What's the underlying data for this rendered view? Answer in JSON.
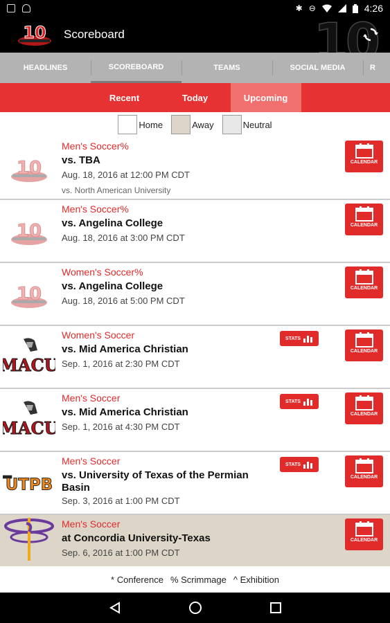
{
  "status_bar": {
    "time": "4:26",
    "left_icons": [
      "download-icon",
      "android-icon"
    ],
    "right_icons": [
      "bluetooth-icon",
      "minus-circle-icon",
      "wifi-icon",
      "signal-icon",
      "battery-icon"
    ]
  },
  "app_bar": {
    "title": "Scoreboard",
    "logo_icon": "mac-10-logo-icon",
    "action_icon": "refresh-icon",
    "bg_mark": "10"
  },
  "nav_tabs": [
    {
      "label": "HEADLINES",
      "active": false
    },
    {
      "label": "SCOREBOARD",
      "active": true
    },
    {
      "label": "TEAMS",
      "active": false
    },
    {
      "label": "SOCIAL MEDIA",
      "active": false
    },
    {
      "label": "R",
      "active": false
    }
  ],
  "filters": [
    {
      "label": "Recent",
      "active": false
    },
    {
      "label": "Today",
      "active": false
    },
    {
      "label": "Upcoming",
      "active": true
    }
  ],
  "legend": [
    {
      "label": "Home",
      "color": "#ffffff"
    },
    {
      "label": "Away",
      "color": "#dcd5c8"
    },
    {
      "label": "Neutral",
      "color": "#e8e8e8"
    }
  ],
  "calendar_label": "CALENDAR",
  "stats_label": "STATS",
  "games": [
    {
      "sport": "Men's Soccer%",
      "opponent": "vs. TBA",
      "datetime": "Aug. 18, 2016 at 12:00 PM CDT",
      "note": "vs. North American University",
      "logo": "red-river-10-logo",
      "type": "home",
      "stats": false
    },
    {
      "sport": "Men's Soccer%",
      "opponent": "vs. Angelina College",
      "datetime": "Aug. 18, 2016 at 3:00 PM CDT",
      "note": "",
      "logo": "red-river-10-logo",
      "type": "home",
      "stats": false
    },
    {
      "sport": "Women's Soccer%",
      "opponent": "vs. Angelina College",
      "datetime": "Aug. 18, 2016 at 5:00 PM CDT",
      "note": "",
      "logo": "red-river-10-logo",
      "type": "home",
      "stats": false
    },
    {
      "sport": "Women's Soccer",
      "opponent": "vs. Mid America Christian",
      "datetime": "Sep. 1, 2016 at 2:30 PM CDT",
      "note": "",
      "logo": "macu-logo",
      "type": "home",
      "stats": true
    },
    {
      "sport": "Men's Soccer",
      "opponent": "vs. Mid America Christian",
      "datetime": "Sep. 1, 2016 at 4:30 PM CDT",
      "note": "",
      "logo": "macu-logo",
      "type": "home",
      "stats": true
    },
    {
      "sport": "Men's Soccer",
      "opponent": "vs. University of Texas of the Permian Basin",
      "datetime": "Sep. 3, 2016 at 1:00 PM CDT",
      "note": "",
      "logo": "utpb-logo",
      "type": "home",
      "stats": true
    },
    {
      "sport": "Men's Soccer",
      "opponent": "at Concordia University-Texas",
      "datetime": "Sep. 6, 2016 at 1:00 PM CDT",
      "note": "",
      "logo": "concordia-logo",
      "type": "away",
      "stats": false
    }
  ],
  "footer_legend": [
    "* Conference",
    "% Scrimmage",
    "^ Exhibition"
  ],
  "logo_text": {
    "red_river": "10",
    "macu": "MACU",
    "utpb": "UTPB"
  },
  "colors": {
    "accent": "#e12a2a",
    "filter_active": "#f07070",
    "tab_bar": "#b3b3b3",
    "away_row": "#dcd5c8"
  },
  "system_nav": [
    "back-icon",
    "home-icon",
    "recents-icon"
  ]
}
